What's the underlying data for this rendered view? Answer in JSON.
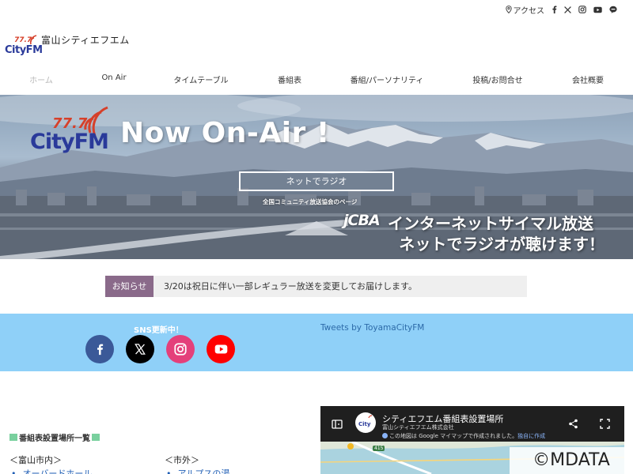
{
  "utility": {
    "access_label": "アクセス"
  },
  "brand": {
    "name": "富山シティエフエム",
    "logo_freq": "77.7",
    "logo_word": "CityFM",
    "accent": "#d6402a",
    "accent_blue": "#2a3a9a"
  },
  "nav": {
    "items": [
      "ホーム",
      "On Air",
      "タイムテーブル",
      "番組表",
      "番組/パーソナリティ",
      "投稿/お問合せ",
      "会社概要"
    ],
    "active_index": 0
  },
  "hero": {
    "title": "Now On-Air !",
    "button_label": "ネットでラジオ",
    "subtitle": "全国コミュニティ放送協会のページ",
    "jcba": "jCBA",
    "promo_line1": "インターネットサイマル放送",
    "promo_line2": "ネットでラジオが聴けます！"
  },
  "notice": {
    "badge": "お知らせ",
    "text": "3/20は祝日に伴い一部レギュラー放送を変更してお届けします。",
    "badge_color": "#8a6a8a"
  },
  "sns": {
    "label": "SNS更新中！",
    "tweets_label": "Tweets by ToyamaCityFM",
    "band_color": "#8fd0f8",
    "icons": [
      {
        "name": "facebook-icon",
        "color": "#3b5998"
      },
      {
        "name": "x-icon",
        "color": "#000000"
      },
      {
        "name": "instagram-icon",
        "color": "#e4407a"
      },
      {
        "name": "youtube-icon",
        "color": "#ff0000"
      }
    ]
  },
  "schedule_list": {
    "title": "番組表設置場所一覧",
    "col1_head": "＜富山市内＞",
    "col1_first": "オーバードホール",
    "col2_head": "＜市外＞",
    "col2_first": "アルプスの湯"
  },
  "map": {
    "title": "シティエフエム番組表設置場所",
    "subtitle": "富山シティエフエム株式会社",
    "note_prefix": "この地図は Google マイマップで作成されました。",
    "note_link": "独自に作成",
    "road_label": "415"
  },
  "watermark": "©MDATA"
}
